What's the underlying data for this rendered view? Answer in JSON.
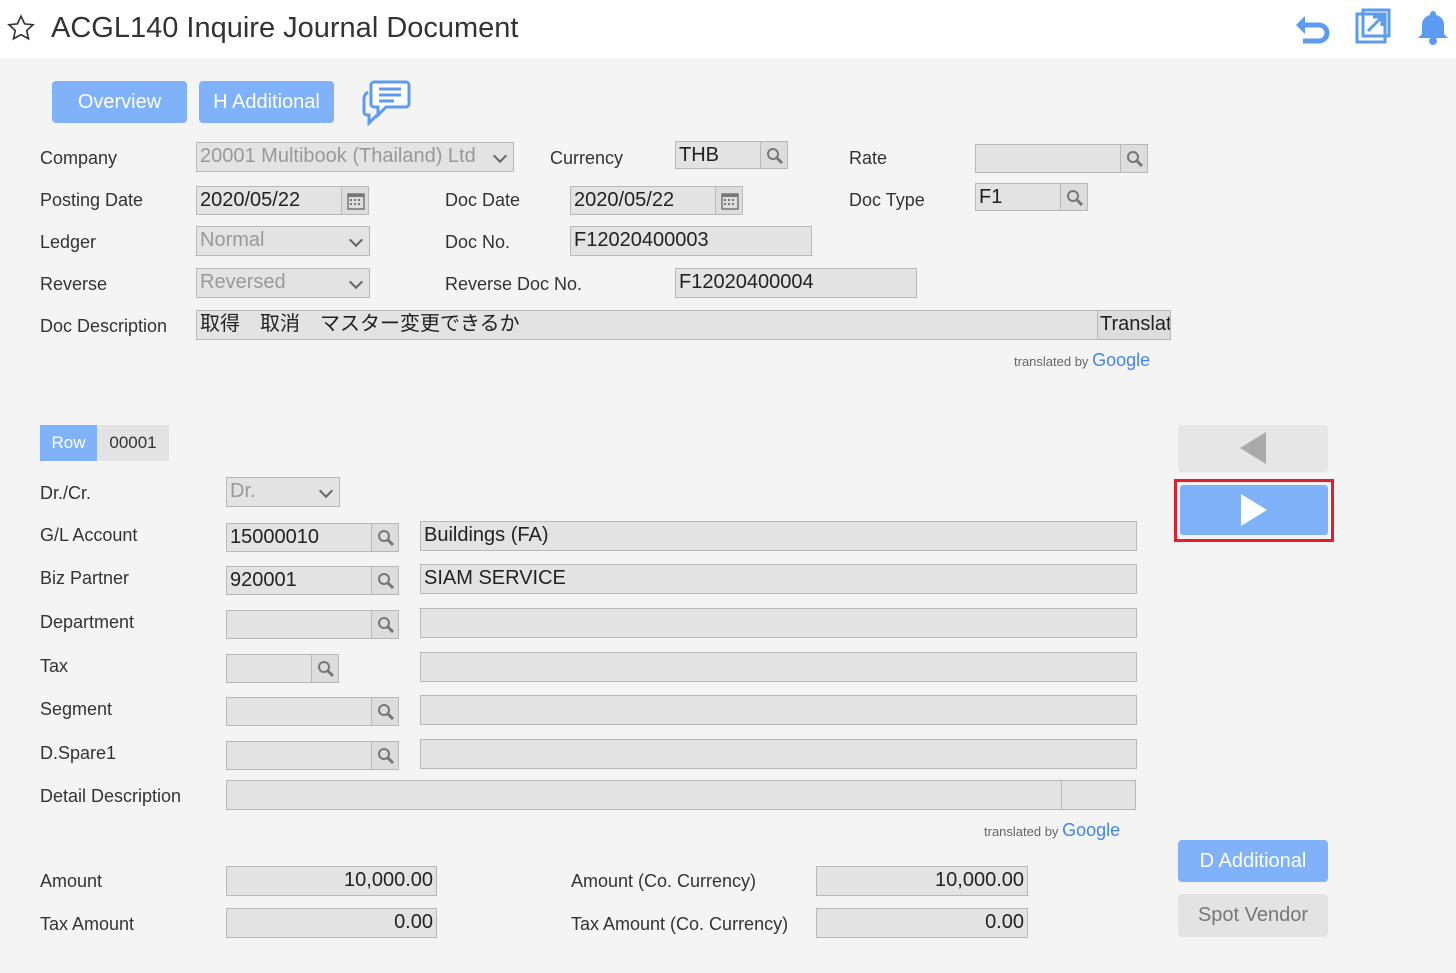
{
  "header": {
    "title": "ACGL140 Inquire Journal Document",
    "icons": [
      "star-icon",
      "undo-icon",
      "popout-icon",
      "bell-icon"
    ],
    "accent": "#5b9bf0"
  },
  "tabs": {
    "overview": "Overview",
    "h_additional": "H Additional"
  },
  "doc": {
    "company_label": "Company",
    "company_value": "20001 Multibook (Thailand) Ltd",
    "currency_label": "Currency",
    "currency_value": "THB",
    "rate_label": "Rate",
    "rate_value": "",
    "posting_date_label": "Posting Date",
    "posting_date_value": "2020/05/22",
    "doc_date_label": "Doc Date",
    "doc_date_value": "2020/05/22",
    "doc_type_label": "Doc Type",
    "doc_type_value": "F1",
    "ledger_label": "Ledger",
    "ledger_value": "Normal",
    "doc_no_label": "Doc No.",
    "doc_no_value": "F12020400003",
    "reverse_label": "Reverse",
    "reverse_value": "Reversed",
    "reverse_doc_no_label": "Reverse Doc No.",
    "reverse_doc_no_value": "F12020400004",
    "doc_description_label": "Doc Description",
    "doc_description_value": "取得　取消　マスター変更できるか",
    "translate_button": "Translat",
    "translated_by": "translated by",
    "google": "Google"
  },
  "row": {
    "row_label": "Row",
    "row_value": "00001",
    "drcr_label": "Dr./Cr.",
    "drcr_value": "Dr.",
    "gl_account_label": "G/L Account",
    "gl_account_value": "15000010",
    "gl_account_name": "Buildings (FA)",
    "biz_partner_label": "Biz Partner",
    "biz_partner_value": "920001",
    "biz_partner_name": "SIAM SERVICE",
    "department_label": "Department",
    "department_value": "",
    "department_name": "",
    "tax_label": "Tax",
    "tax_value": "",
    "tax_name": "",
    "segment_label": "Segment",
    "segment_value": "",
    "segment_name": "",
    "dspare1_label": "D.Spare1",
    "dspare1_value": "",
    "dspare1_name": "",
    "detail_description_label": "Detail Description",
    "detail_description_value": "",
    "translated_by": "translated by",
    "google": "Google",
    "amount_label": "Amount",
    "amount_value": "10,000.00",
    "amount_co_label": "Amount (Co. Currency)",
    "amount_co_value": "10,000.00",
    "tax_amount_label": "Tax Amount",
    "tax_amount_value": "0.00",
    "tax_amount_co_label": "Tax Amount (Co. Currency)",
    "tax_amount_co_value": "0.00"
  },
  "side": {
    "d_additional": "D Additional",
    "spot_vendor": "Spot Vendor"
  }
}
